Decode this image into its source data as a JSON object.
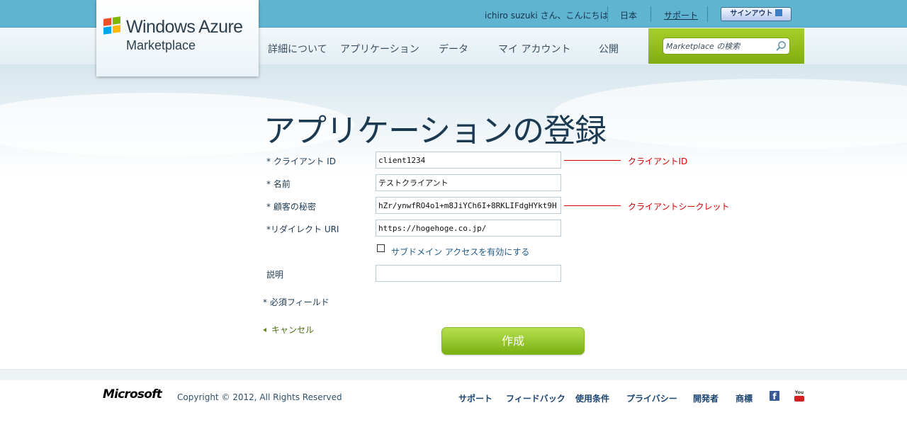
{
  "header": {
    "logo": {
      "brand": "Windows Azure",
      "subtitle": "Marketplace"
    },
    "greeting": "ichiro suzuki さん、こんにちは",
    "links": {
      "region": "日本",
      "support": "サポート",
      "signout": "サインアウト"
    },
    "nav": [
      "詳細について",
      "アプリケーション",
      "データ",
      "マイ アカウント",
      "公開"
    ],
    "search": {
      "placeholder": "Marketplace の検索"
    }
  },
  "page": {
    "title": "アプリケーションの登録"
  },
  "form": {
    "client_id": {
      "label": "* クライアント ID",
      "value": "client1234"
    },
    "name": {
      "label": "* 名前",
      "value": "テストクライアント"
    },
    "secret": {
      "label": "* 顧客の秘密",
      "value": "hZr/ynwfRO4o1+m8JiYCh6I+8RKLIFdgHYkt9H"
    },
    "redirect_uri": {
      "label": "*リダイレクト URI",
      "value": "https://hogehoge.co.jp/"
    },
    "subdomain": {
      "label": "サブドメイン アクセスを有効にする",
      "checked": false
    },
    "description": {
      "label": "説明",
      "value": ""
    },
    "required_note": "* 必須フィールド",
    "cancel": "キャンセル",
    "create": "作成"
  },
  "annotations": {
    "client_id": "クライアントID",
    "client_secret": "クライアントシークレット",
    "color": "#d40000"
  },
  "footer": {
    "logo": "Microsoft",
    "copyright": "Copyright © 2012, All Rights Reserved",
    "links": [
      "サポート",
      "フィードバック",
      "使用条件",
      "プライバシー",
      "開発者",
      "商標"
    ],
    "icons": [
      "facebook-icon",
      "youtube-icon"
    ]
  },
  "colors": {
    "accent_green": "#8dbb14",
    "top_bar": "#5fb4d2",
    "title": "#1b3a52"
  }
}
